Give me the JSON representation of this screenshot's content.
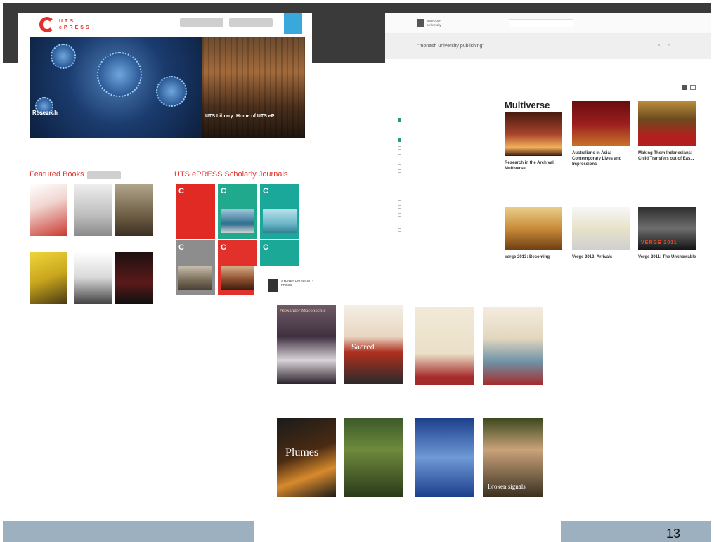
{
  "slide": {
    "number": "13"
  },
  "uts": {
    "logo_text": "UTS ePRESS",
    "top_buttons": [
      "",
      ""
    ],
    "ribbon": "",
    "hero_left": {
      "title": "Research",
      "subtitle": ""
    },
    "hero_right": {
      "title": "UTS Library: Home of UTS eP",
      "subtitle": ""
    },
    "intro_text": "",
    "featured_title": "Featured Books",
    "featured_pill": "",
    "journals_title": "UTS ePRESS Scholarly Journals",
    "book_labels": [
      "",
      "",
      "",
      "",
      "",
      ""
    ],
    "tile_letter": "C"
  },
  "monash": {
    "logo_text": "MONASH University",
    "nav_label": "",
    "select_label": "",
    "login_label": "",
    "search_text": "\"monash university publishing\"",
    "multiverse": "Multiverse",
    "books": [
      {
        "title": "Research in the Archival Multiverse"
      },
      {
        "title": "Australians in Asia: Contemporary Lives and Impressions"
      },
      {
        "title": "Making Them Indonesians: Child Transfers out of Eas..."
      },
      {
        "title": "Verge 2013: Becoming"
      },
      {
        "title": "Verge 2012: Arrivals"
      },
      {
        "title": "Verge 2011: The Unknowable"
      }
    ],
    "verge_cover_text": "VERGE 2011"
  },
  "sydney": {
    "logo_text": "SYDNEY UNIVERSITY PRESS",
    "books": [
      {
        "cover_text": "Alexander Maconochie"
      },
      {
        "cover_text": "Sacred"
      },
      {
        "cover_text": ""
      },
      {
        "cover_text": ""
      },
      {
        "cover_text": "Plumes"
      },
      {
        "cover_text": ""
      },
      {
        "cover_text": ""
      },
      {
        "cover_text": "Broken signals"
      }
    ]
  }
}
